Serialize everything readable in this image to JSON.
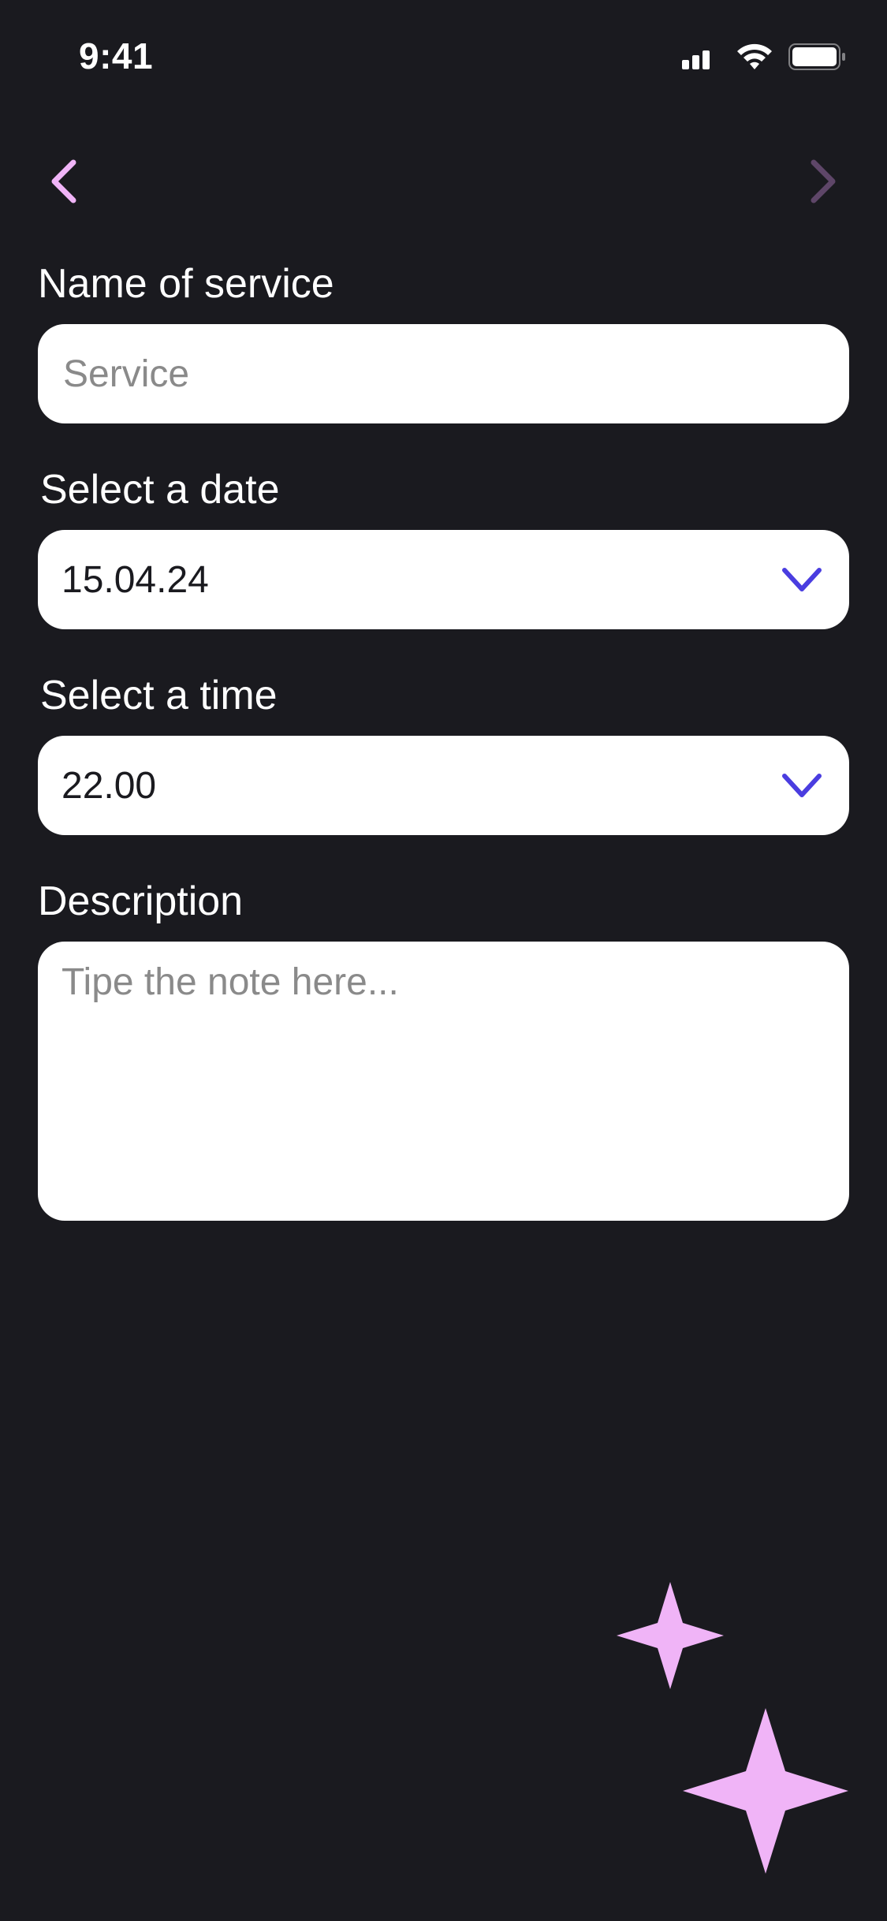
{
  "status_bar": {
    "time": "9:41"
  },
  "nav": {
    "back_icon": "chevron-left-icon",
    "forward_icon": "chevron-right-icon"
  },
  "form": {
    "service": {
      "label": "Name of service",
      "value": "",
      "placeholder": "Service"
    },
    "date": {
      "label": "Select a date",
      "value": "15.04.24"
    },
    "time": {
      "label": "Select a time",
      "value": "22.00"
    },
    "description": {
      "label": "Description",
      "value": "",
      "placeholder": "Tipe the note here..."
    }
  },
  "colors": {
    "background": "#1a1a1f",
    "accent_pink": "#f0b4f7",
    "accent_pink_dim": "#5e4668",
    "accent_indigo": "#4a3de0",
    "field_bg": "#ffffff",
    "placeholder": "#8a8a8a"
  }
}
